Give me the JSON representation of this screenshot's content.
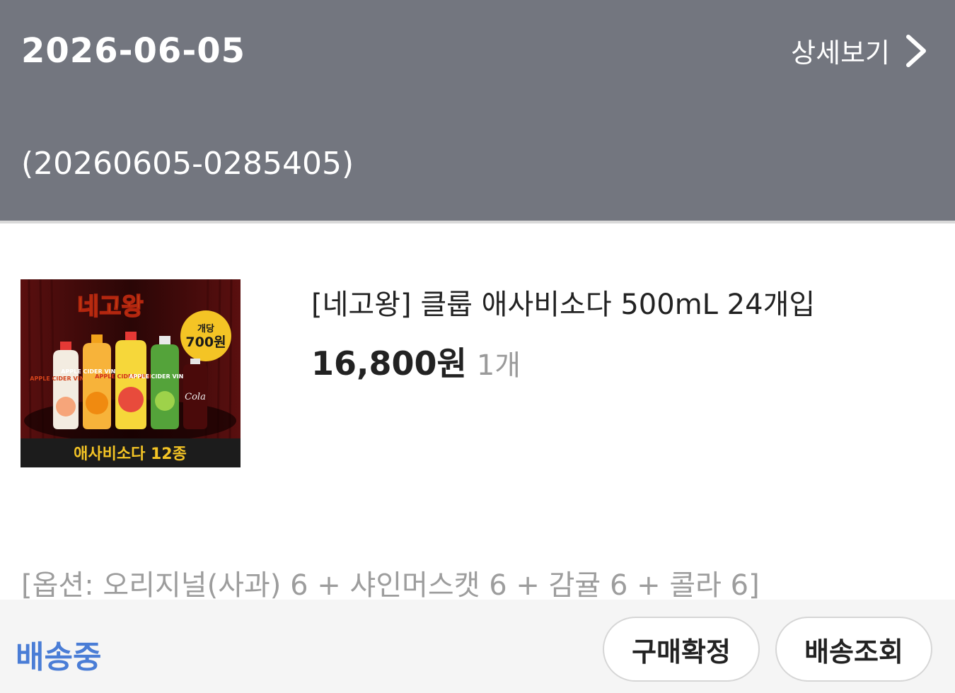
{
  "order": {
    "date": "2026-06-05",
    "detail_label": "상세보기",
    "number": "(20260605-0285405)"
  },
  "product": {
    "name": "[네고왕] 클룹 애사비소다 500mL 24개입",
    "price": "16,800원",
    "quantity": "1개",
    "option": "[옵션: 오리지널(사과) 6 + 샤인머스캣 6 + 감귤 6 + 콜라 6]",
    "image": {
      "brand_text": "네고왕",
      "badge_top": "개당",
      "badge_price": "700원",
      "banner_text": "애사비소다 12종",
      "bottle_labels": [
        "APPLE CIDER VINEGAR",
        "APPLE CIDER VINEGAR",
        "APPLE CIDER VINEGAR",
        "APPLE CIDER VINEGAR",
        "Cola"
      ]
    }
  },
  "footer": {
    "status": "배송중",
    "confirm_label": "구매확정",
    "track_label": "배송조회"
  },
  "colors": {
    "header_bg": "#73767f",
    "status_blue": "#4a7dd6",
    "footer_bg": "#f5f5f5"
  }
}
